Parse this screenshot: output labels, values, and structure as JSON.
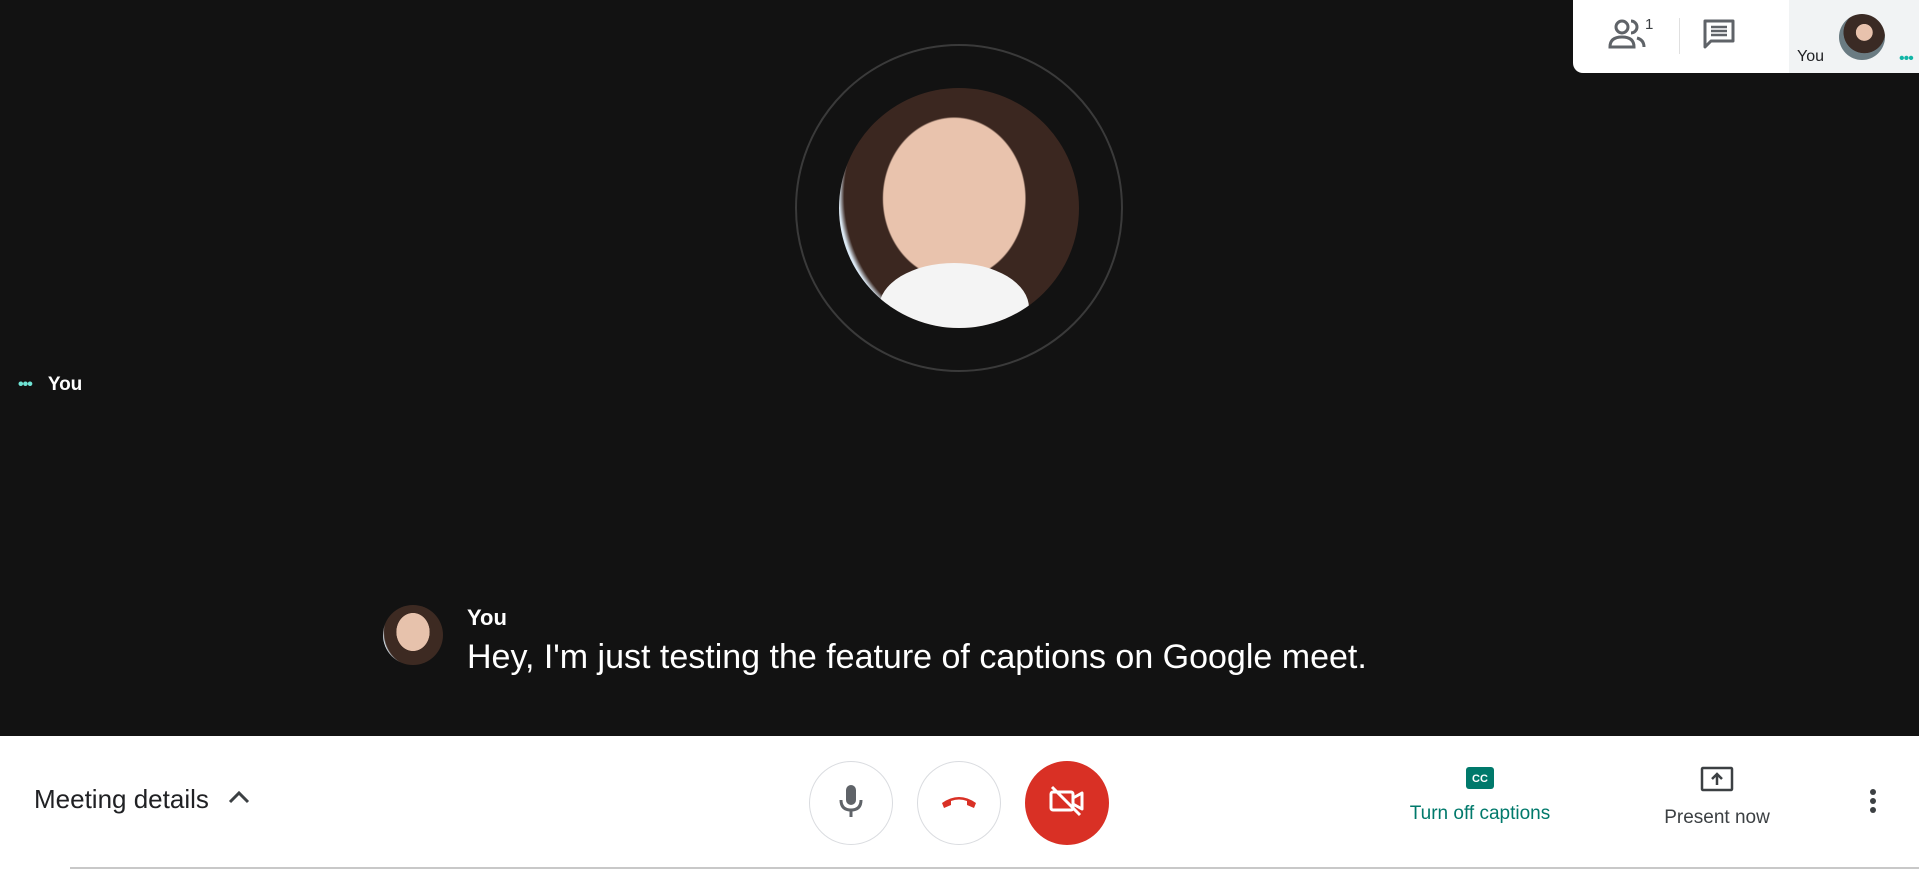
{
  "top_panel": {
    "participant_count": "1",
    "self_tile_label": "You",
    "self_tile_dots": "•••"
  },
  "stage": {
    "left_tag_dots": "•••",
    "left_tag_name": "You"
  },
  "captions": {
    "speaker": "You",
    "text": "Hey, I'm just testing the feature of captions on Google meet."
  },
  "bottom_bar": {
    "meeting_details_label": "Meeting details",
    "captions_button_label": "Turn off captions",
    "present_button_label": "Present now"
  },
  "colors": {
    "stage_background": "#121212",
    "accent_teal": "#00796b",
    "hangup_red": "#d93025",
    "speaking_dots": "#12b5a6"
  },
  "icons": [
    "people-icon",
    "chat-icon",
    "mic-icon",
    "call-end-icon",
    "camera-off-icon",
    "captions-icon",
    "present-icon",
    "more-vert-icon",
    "chevron-up-icon"
  ]
}
